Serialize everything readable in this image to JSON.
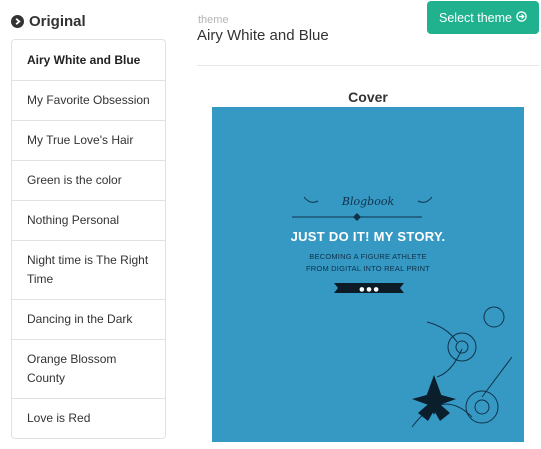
{
  "sidebar": {
    "header": "Original",
    "items": [
      {
        "label": "Airy White and Blue",
        "active": true
      },
      {
        "label": "My Favorite Obsession",
        "active": false
      },
      {
        "label": "My True Love's Hair",
        "active": false
      },
      {
        "label": "Green is the color",
        "active": false
      },
      {
        "label": "Nothing Personal",
        "active": false
      },
      {
        "label": "Night time is The Right Time",
        "active": false
      },
      {
        "label": "Dancing in the Dark",
        "active": false
      },
      {
        "label": "Orange Blossom County",
        "active": false
      },
      {
        "label": "Love is Red",
        "active": false
      }
    ]
  },
  "main": {
    "caption": "theme",
    "theme_name": "Airy White and Blue",
    "select_button": "Select theme",
    "cover_label": "Cover",
    "cover": {
      "logo": "Blogbook",
      "title": "JUST DO IT! MY STORY.",
      "subtitle_1": "BECOMING A FIGURE ATHLETE",
      "subtitle_2": "FROM DIGITAL INTO REAL PRINT",
      "background": "#3699c4"
    }
  },
  "colors": {
    "accent": "#20b28e",
    "border": "#e2e2e2",
    "text": "#333333"
  }
}
